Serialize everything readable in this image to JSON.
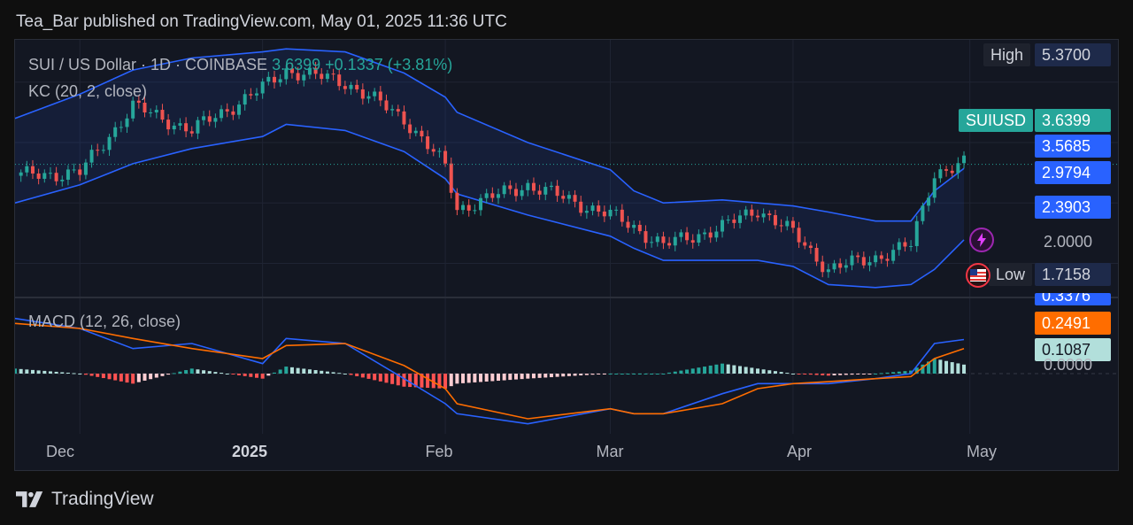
{
  "header": {
    "published": "Tea_Bar published on TradingView.com, May 01, 2025 11:36 UTC"
  },
  "legend": {
    "symbol": "SUI / US Dollar · 1D · COINBASE",
    "last_value": "3.6399",
    "change": "+0.1337 (+3.81%)",
    "kc": "KC (20, 2, close)",
    "macd": "MACD (12, 26, close)"
  },
  "price_axis": {
    "high_label": "High",
    "high_value": "5.3700",
    "symbol_label": "SUIUSD",
    "last_value": "3.6399",
    "kc_upper": "3.5685",
    "kc_middle": "2.9794",
    "kc_lower": "2.3903",
    "level": "2.0000",
    "low_label": "Low",
    "low_value": "1.7158"
  },
  "macd_axis": {
    "macd_value": "0.3376",
    "signal_value": "0.2491",
    "hist_value": "0.1087",
    "zero": "0.0000"
  },
  "time_axis": [
    "Dec",
    "2025",
    "Feb",
    "Mar",
    "Apr",
    "May"
  ],
  "footer": {
    "brand": "TradingView"
  },
  "colors": {
    "up": "#26a69a",
    "down": "#ef5350",
    "band": "#2962ff",
    "macd": "#2962ff",
    "signal": "#ff6d00",
    "hist_up": "#26a69a",
    "hist_up_fade": "#b2dfdb",
    "hist_down": "#ff5252",
    "hist_down_fade": "#ffcdd2"
  },
  "chart_data": {
    "type": "line",
    "x_range": [
      "2024-11-20",
      "2025-05-03"
    ],
    "price_ylim": [
      1.45,
      5.7
    ],
    "macd_ylim": [
      -0.6,
      0.75
    ],
    "price": {
      "dates": [
        "2024-11-20",
        "2024-12-01",
        "2024-12-10",
        "2024-12-20",
        "2025-01-01",
        "2025-01-05",
        "2025-01-15",
        "2025-01-25",
        "2025-02-01",
        "2025-02-03",
        "2025-02-15",
        "2025-03-01",
        "2025-03-05",
        "2025-03-10",
        "2025-03-20",
        "2025-03-26",
        "2025-04-01",
        "2025-04-07",
        "2025-04-15",
        "2025-04-21",
        "2025-04-25",
        "2025-04-30"
      ],
      "close": [
        3.45,
        3.5,
        4.6,
        4.2,
        4.9,
        5.2,
        5.0,
        4.4,
        3.6,
        2.9,
        3.3,
        2.8,
        2.6,
        2.3,
        2.6,
        2.9,
        2.5,
        1.9,
        2.1,
        2.3,
        3.5,
        3.64
      ]
    },
    "keltner": {
      "name": "KC (20, 2, close)",
      "upper": [
        4.4,
        4.8,
        5.2,
        5.4,
        5.5,
        5.55,
        5.5,
        5.15,
        4.75,
        4.5,
        4.0,
        3.55,
        3.2,
        3.0,
        3.05,
        3.0,
        2.95,
        2.85,
        2.7,
        2.7,
        3.2,
        3.57
      ],
      "middle": [
        3.7,
        4.0,
        4.4,
        4.65,
        4.8,
        4.9,
        4.85,
        4.5,
        4.1,
        3.85,
        3.4,
        3.0,
        2.75,
        2.55,
        2.55,
        2.5,
        2.45,
        2.25,
        2.05,
        2.05,
        2.5,
        2.98
      ],
      "lower": [
        3.0,
        3.3,
        3.65,
        3.9,
        4.1,
        4.3,
        4.2,
        3.85,
        3.4,
        3.15,
        2.8,
        2.45,
        2.25,
        2.05,
        2.05,
        2.05,
        1.95,
        1.65,
        1.6,
        1.65,
        1.9,
        2.39
      ]
    },
    "macd": {
      "name": "MACD (12, 26, close)",
      "macd": [
        0.55,
        0.45,
        0.25,
        0.3,
        0.1,
        0.35,
        0.3,
        -0.05,
        -0.3,
        -0.4,
        -0.5,
        -0.35,
        -0.4,
        -0.4,
        -0.2,
        -0.1,
        -0.1,
        -0.1,
        -0.05,
        0.0,
        0.3,
        0.34
      ],
      "signal": [
        0.5,
        0.45,
        0.35,
        0.25,
        0.15,
        0.28,
        0.3,
        0.08,
        -0.15,
        -0.3,
        -0.45,
        -0.35,
        -0.4,
        -0.4,
        -0.3,
        -0.15,
        -0.1,
        -0.08,
        -0.05,
        -0.03,
        0.15,
        0.25
      ]
    }
  }
}
